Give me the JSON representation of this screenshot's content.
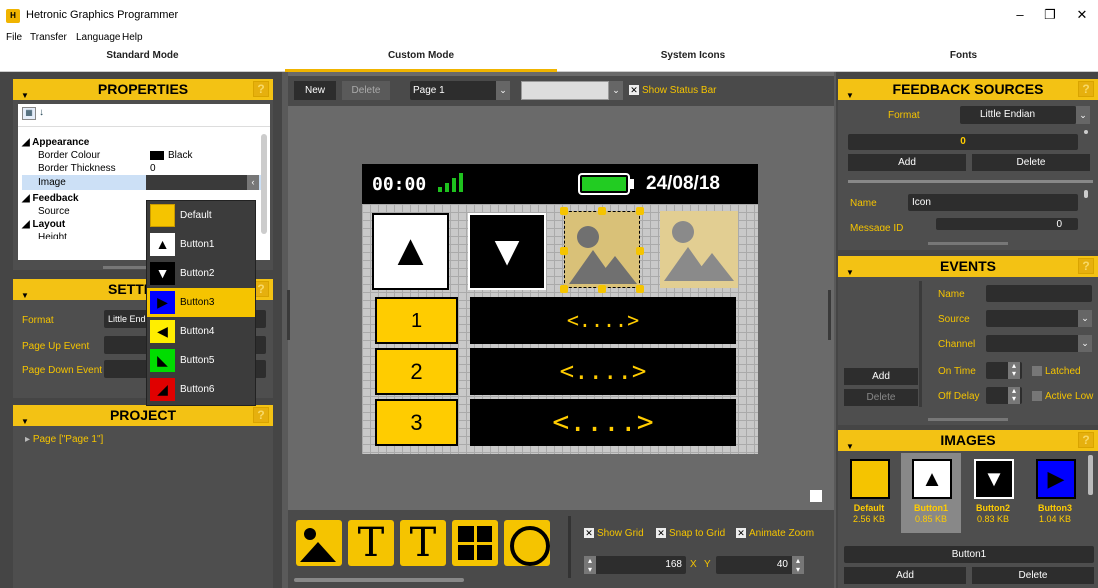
{
  "window": {
    "title": "Hetronic Graphics Programmer",
    "icon_text": "H"
  },
  "menu": [
    "File",
    "Transfer",
    "Language",
    "Help"
  ],
  "mode_tabs": [
    "Standard Mode",
    "Custom Mode",
    "System Icons",
    "Fonts"
  ],
  "properties": {
    "title": "PROPERTIES",
    "groups": {
      "appearance": "Appearance",
      "feedback": "Feedback",
      "layout": "Layout"
    },
    "rows": {
      "border_colour": {
        "label": "Border Colour",
        "value": "Black"
      },
      "border_thickness": {
        "label": "Border Thickness",
        "value": "0"
      },
      "image": {
        "label": "Image",
        "value": ""
      },
      "source": {
        "label": "Source",
        "value": ""
      },
      "height": {
        "label": "Height",
        "value": ""
      }
    }
  },
  "image_dropdown": [
    "Default",
    "Button1",
    "Button2",
    "Button3",
    "Button4",
    "Button5",
    "Button6"
  ],
  "settings": {
    "title": "SETTINGS",
    "format_label": "Format",
    "format_value": "Little Endian",
    "page_up_label": "Page Up Event",
    "page_down_label": "Page Down Event"
  },
  "project": {
    "title": "PROJECT",
    "item": "Page [\"Page 1\"]"
  },
  "toolbar": {
    "new": "New",
    "delete": "Delete",
    "page": "Page 1",
    "show_status_bar": "Show Status Bar"
  },
  "screen": {
    "time": "00:00",
    "date": "24/08/18",
    "rows": [
      "1",
      "2",
      "3"
    ],
    "arrows": [
      "<....>",
      "<....>",
      "<....>"
    ]
  },
  "bottom": {
    "show_grid": "Show Grid",
    "snap_to_grid": "Snap to Grid",
    "animate_zoom": "Animate Zoom",
    "x_value": "168",
    "x_label": "X",
    "y_label": "Y",
    "y_value": "40"
  },
  "feedback": {
    "title": "FEEDBACK SOURCES",
    "format_label": "Format",
    "format_value": "Little Endian",
    "value": "0",
    "add": "Add",
    "delete": "Delete",
    "name_label": "Name",
    "name_value": "Icon",
    "message_id_label": "Message ID",
    "message_id_value": "0"
  },
  "events": {
    "title": "EVENTS",
    "name": "Name",
    "source": "Source",
    "channel": "Channel",
    "on_time": "On Time",
    "latched": "Latched",
    "off_delay": "Off Delay",
    "active_low": "Active Low",
    "add": "Add",
    "delete": "Delete"
  },
  "images": {
    "title": "IMAGES",
    "items": [
      {
        "name": "Default",
        "size": "2.56 KB"
      },
      {
        "name": "Button1",
        "size": "0.85 KB"
      },
      {
        "name": "Button2",
        "size": "0.83 KB"
      },
      {
        "name": "Button3",
        "size": "1.04 KB"
      }
    ],
    "selected": "Button1",
    "add": "Add",
    "delete": "Delete"
  }
}
